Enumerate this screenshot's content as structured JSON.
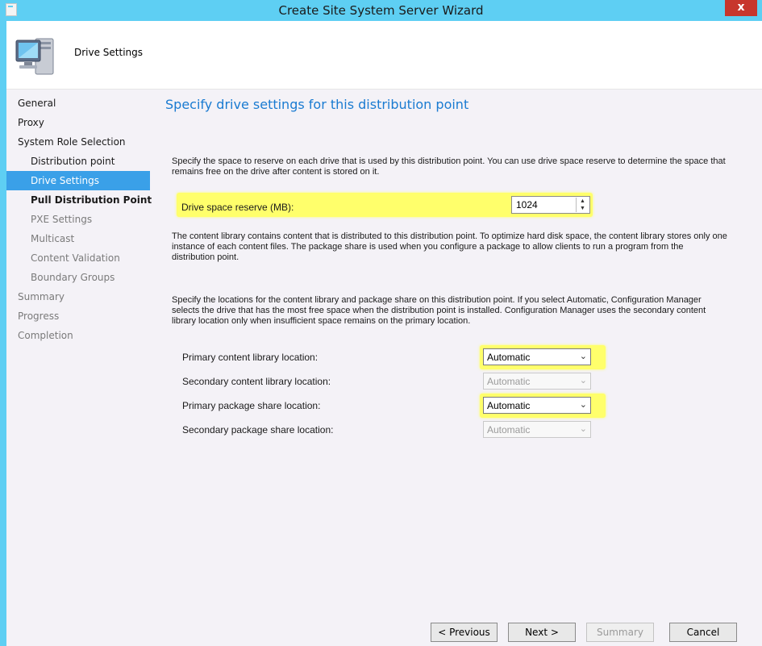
{
  "window": {
    "title": "Create Site System Server Wizard",
    "close_glyph": "x"
  },
  "header": {
    "title": "Drive Settings",
    "icon": "computer-server-icon"
  },
  "nav": {
    "items": [
      {
        "label": "General"
      },
      {
        "label": "Proxy"
      },
      {
        "label": "System Role Selection"
      },
      {
        "label": "Distribution point"
      },
      {
        "label": "Drive Settings"
      },
      {
        "label": "Pull Distribution Point"
      },
      {
        "label": "PXE Settings"
      },
      {
        "label": "Multicast"
      },
      {
        "label": "Content Validation"
      },
      {
        "label": "Boundary Groups"
      },
      {
        "label": "Summary"
      },
      {
        "label": "Progress"
      },
      {
        "label": "Completion"
      }
    ]
  },
  "main": {
    "heading": "Specify drive settings for this distribution point",
    "para1": "Specify the space to reserve on each drive that is used by this distribution point. You can use drive space reserve to determine the space that remains free on the drive after content is stored on it.",
    "reserve_label": "Drive space reserve (MB):",
    "reserve_value": "1024",
    "para2": "The content library contains content that is distributed to this distribution point. To optimize hard disk space, the content library stores only one instance of each content files. The package share is used when you configure a package to allow clients to run a program from the distribution point.",
    "para3": "Specify the locations for the content library and package share on this distribution point. If you select Automatic, Configuration Manager selects the drive that has the most free space when the distribution point is installed. Configuration Manager uses the secondary content library location only when insufficient space remains on the primary location.",
    "locations": [
      {
        "label": "Primary content library location:",
        "value": "Automatic"
      },
      {
        "label": "Secondary content library location:",
        "value": "Automatic"
      },
      {
        "label": "Primary package share location:",
        "value": "Automatic"
      },
      {
        "label": "Secondary package share location:",
        "value": "Automatic"
      }
    ]
  },
  "buttons": {
    "previous": "< Previous",
    "next": "Next >",
    "summary": "Summary",
    "cancel": "Cancel"
  },
  "colors": {
    "titlebar": "#5ecff3",
    "accent": "#3aa0e8",
    "highlight": "#ffff6b",
    "heading": "#1a7bd1",
    "close": "#c7362c"
  }
}
